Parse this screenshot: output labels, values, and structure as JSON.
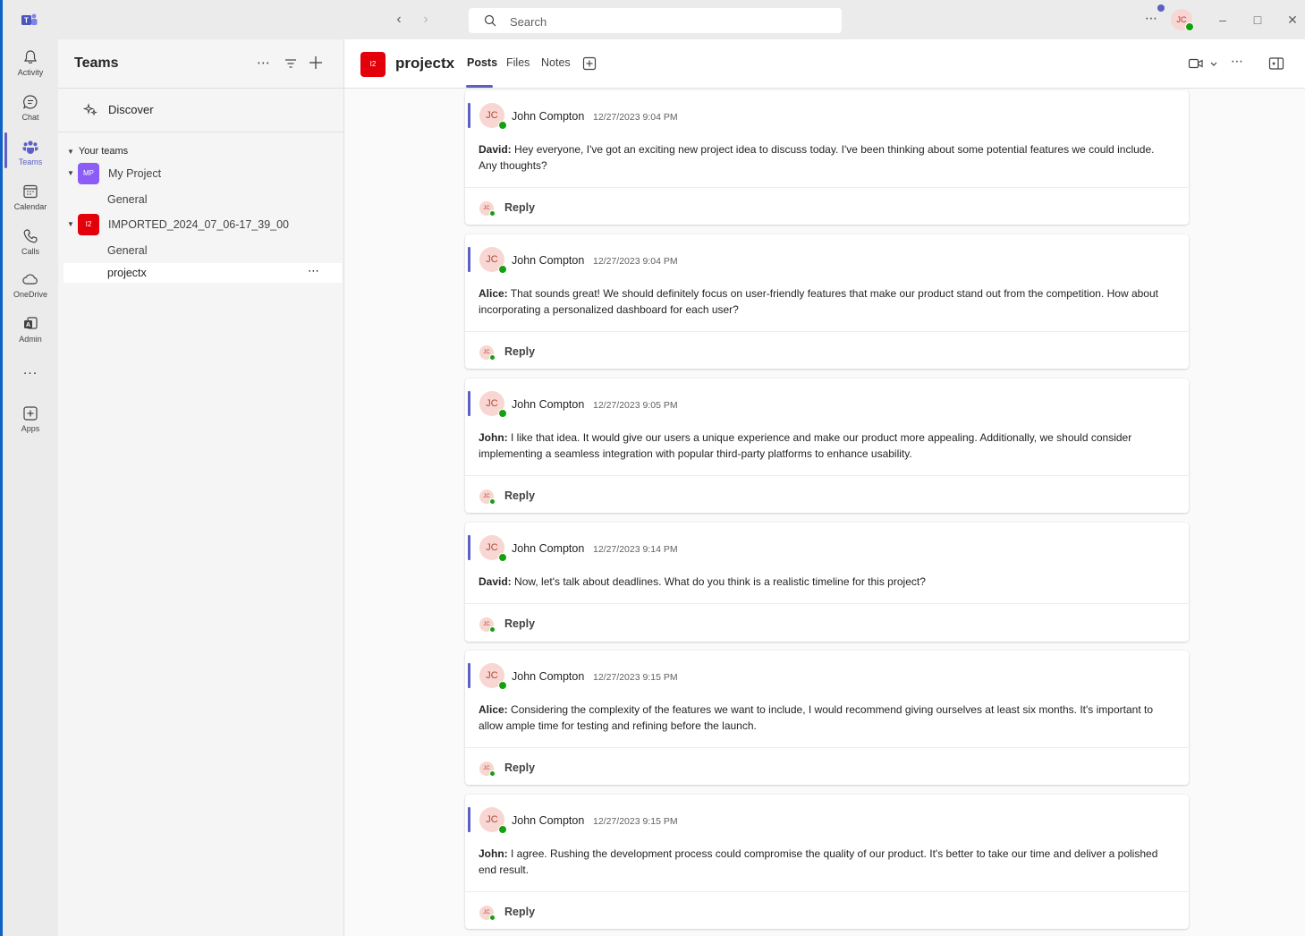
{
  "titlebar": {
    "search_placeholder": "Search",
    "user_initials": "JC"
  },
  "rail": {
    "items": [
      {
        "label": "Activity",
        "icon": "bell-icon"
      },
      {
        "label": "Chat",
        "icon": "chat-icon"
      },
      {
        "label": "Teams",
        "icon": "teams-icon"
      },
      {
        "label": "Calendar",
        "icon": "calendar-icon"
      },
      {
        "label": "Calls",
        "icon": "phone-icon"
      },
      {
        "label": "OneDrive",
        "icon": "cloud-icon"
      },
      {
        "label": "Admin",
        "icon": "admin-icon"
      },
      {
        "label": "Apps",
        "icon": "add-apps-icon"
      }
    ],
    "active": "Teams",
    "more": "..."
  },
  "teams_pane": {
    "title": "Teams",
    "discover": "Discover",
    "your_teams": "Your teams",
    "teams": [
      {
        "badge": "MP",
        "name": "My Project",
        "color": "#8b5cf6",
        "channels": [
          "General"
        ]
      },
      {
        "badge": "I2",
        "name": "IMPORTED_2024_07_06-17_39_00",
        "color": "#e3000b",
        "channels": [
          "General",
          "projectx"
        ]
      }
    ],
    "selected_channel": "projectx"
  },
  "channel": {
    "badge": "I2",
    "title": "projectx",
    "tabs": [
      "Posts",
      "Files",
      "Notes"
    ],
    "active_tab": "Posts"
  },
  "posts": [
    {
      "initials": "JC",
      "author": "John Compton",
      "time": "12/27/2023 9:04 PM",
      "speaker": "David:",
      "text": " Hey everyone, I've got an exciting new project idea to discuss today. I've been thinking about some potential features we could include. Any thoughts?",
      "reply": "Reply"
    },
    {
      "initials": "JC",
      "author": "John Compton",
      "time": "12/27/2023 9:04 PM",
      "speaker": "Alice:",
      "text": " That sounds great! We should definitely focus on user-friendly features that make our product stand out from the competition. How about incorporating a personalized dashboard for each user?",
      "reply": "Reply"
    },
    {
      "initials": "JC",
      "author": "John Compton",
      "time": "12/27/2023 9:05 PM",
      "speaker": "John:",
      "text": " I like that idea. It would give our users a unique experience and make our product more appealing. Additionally, we should consider implementing a seamless integration with popular third-party platforms to enhance usability.",
      "reply": "Reply"
    },
    {
      "initials": "JC",
      "author": "John Compton",
      "time": "12/27/2023 9:14 PM",
      "speaker": "David:",
      "text": " Now, let's talk about deadlines. What do you think is a realistic timeline for this project?",
      "reply": "Reply"
    },
    {
      "initials": "JC",
      "author": "John Compton",
      "time": "12/27/2023 9:15 PM",
      "speaker": "Alice:",
      "text": " Considering the complexity of the features we want to include, I would recommend giving ourselves at least six months. It's important to allow ample time for testing and refining before the launch.",
      "reply": "Reply"
    },
    {
      "initials": "JC",
      "author": "John Compton",
      "time": "12/27/2023 9:15 PM",
      "speaker": "John:",
      "text": " I agree. Rushing the development process could compromise the quality of our product. It's better to take our time and deliver a polished end result.",
      "reply": "Reply"
    }
  ],
  "colors": {
    "accent": "#5b5fc7",
    "presence": "#13a10e"
  }
}
